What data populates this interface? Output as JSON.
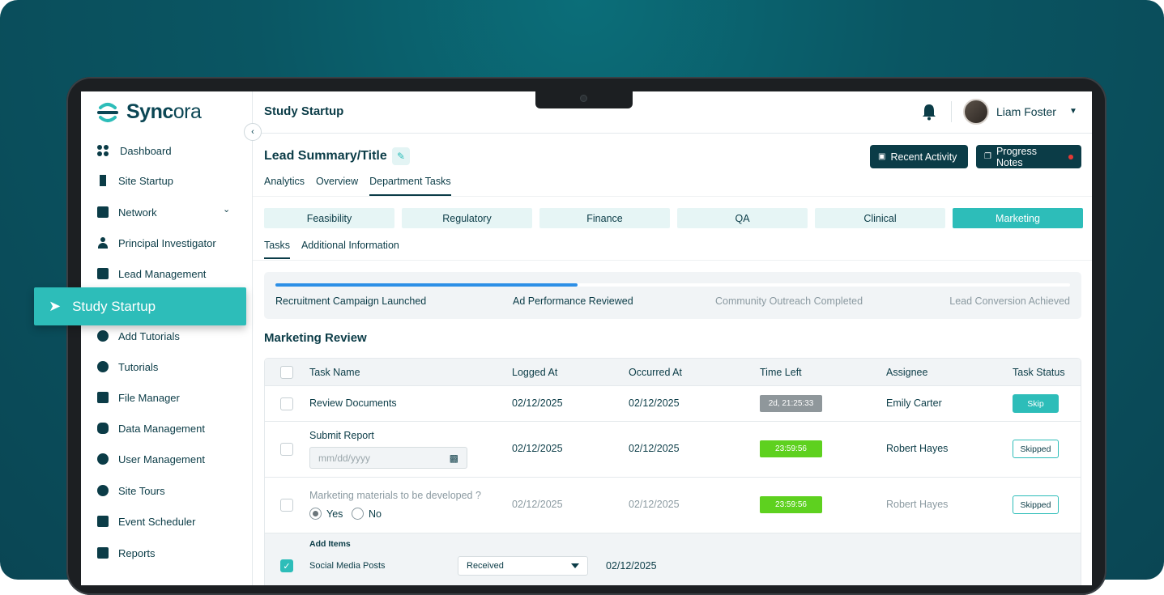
{
  "app": {
    "name_main": "Sync",
    "name_tail": "ora"
  },
  "sidebar": {
    "items": [
      {
        "label": "Dashboard",
        "icon": "grid-icon"
      },
      {
        "label": "Site Startup",
        "icon": "building-icon"
      },
      {
        "label": "Network",
        "icon": "network-icon"
      },
      {
        "label": "Principal Investigator",
        "icon": "person-icon"
      },
      {
        "label": "Lead Management",
        "icon": "document-icon"
      },
      {
        "label": "Add Tutorials",
        "icon": "play-plus-icon"
      },
      {
        "label": "Tutorials",
        "icon": "play-icon"
      },
      {
        "label": "File Manager",
        "icon": "folder-icon"
      },
      {
        "label": "Data Management",
        "icon": "database-icon"
      },
      {
        "label": "User Management",
        "icon": "gear-user-icon"
      },
      {
        "label": "Site Tours",
        "icon": "globe-icon"
      },
      {
        "label": "Event Scheduler",
        "icon": "calendar-icon"
      },
      {
        "label": "Reports",
        "icon": "report-icon"
      }
    ],
    "active": "Study Startup"
  },
  "header": {
    "title": "Study Startup",
    "user": "Liam Foster"
  },
  "main": {
    "lead_title": "Lead Summary/Title",
    "buttons": {
      "recent": "Recent Activity",
      "notes": "Progress Notes"
    },
    "tabs": [
      "Analytics",
      "Overview",
      "Department Tasks"
    ],
    "departments": [
      "Feasibility",
      "Regulatory",
      "Finance",
      "QA",
      "Clinical",
      "Marketing"
    ],
    "subtabs": [
      "Tasks",
      "Additional Information"
    ],
    "progress": {
      "fraction": 0.38,
      "steps": [
        "Recruitment Campaign Launched",
        "Ad Performance Reviewed",
        "Community Outreach Completed",
        "Lead Conversion Achieved"
      ]
    },
    "section_title": "Marketing Review",
    "table": {
      "headers": [
        "Task Name",
        "Logged At",
        "Occurred At",
        "Time Left",
        "Assignee",
        "Task Status"
      ],
      "rows": [
        {
          "task": "Review Documents",
          "logged": "02/12/2025",
          "occurred": "02/12/2025",
          "time_left": "2d, 21:25:33",
          "assignee": "Emily Carter",
          "status": "Skip"
        },
        {
          "task": "Submit Report",
          "date_placeholder": "mm/dd/yyyy",
          "logged": "02/12/2025",
          "occurred": "02/12/2025",
          "time_left": "23:59:56",
          "assignee": "Robert Hayes",
          "status": "Skipped"
        },
        {
          "task": "Marketing materials to be developed ?",
          "yes": "Yes",
          "no": "No",
          "logged": "02/12/2025",
          "occurred": "02/12/2025",
          "time_left": "23:59:56",
          "assignee": "Robert Hayes",
          "status": "Skipped"
        }
      ],
      "add_items": {
        "title": "Add Items",
        "item": "Social Media Posts",
        "select_value": "Received",
        "date": "02/12/2025"
      }
    }
  }
}
